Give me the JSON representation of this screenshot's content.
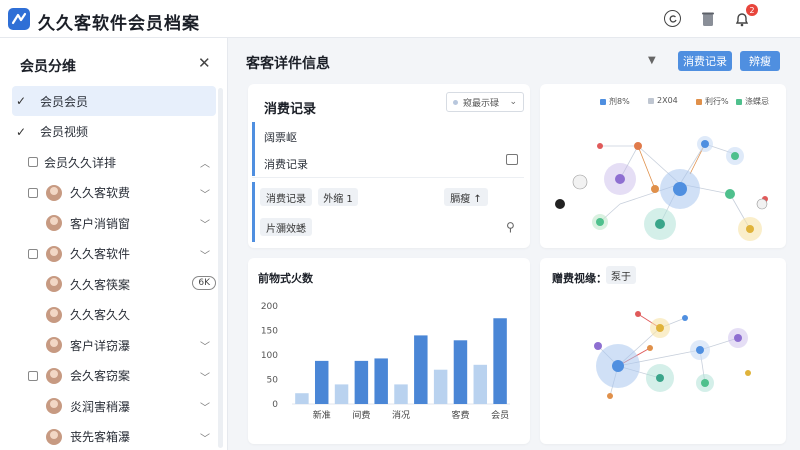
{
  "header": {
    "title": "久久客软件会员档案",
    "notification_count": "2"
  },
  "sidebar": {
    "title": "会员分维",
    "items": [
      {
        "label": "会员会员",
        "kind": "check",
        "active": true
      },
      {
        "label": "会员视频",
        "kind": "check"
      },
      {
        "label": "会员久久详排",
        "kind": "box",
        "chevron": "up"
      },
      {
        "label": "久久客软费",
        "kind": "box-avatar",
        "chevron": "down"
      },
      {
        "label": "客户消销窗",
        "kind": "avatar",
        "chevron": "down"
      },
      {
        "label": "久久客软件",
        "kind": "box-avatar",
        "chevron": "down"
      },
      {
        "label": "久久客筷案",
        "kind": "avatar",
        "pill": "6K"
      },
      {
        "label": "久久客久久",
        "kind": "avatar"
      },
      {
        "label": "客户详窃瀑",
        "kind": "avatar",
        "chevron": "down"
      },
      {
        "label": "会久客窃案",
        "kind": "box-avatar",
        "chevron": "down"
      },
      {
        "label": "炎润害稍瀑",
        "kind": "avatar",
        "chevron": "down"
      },
      {
        "label": "丧先客箱瀑",
        "kind": "avatar",
        "chevron": "down"
      }
    ]
  },
  "main": {
    "title": "客客详件信息",
    "buttons": {
      "primary": "消费记录",
      "secondary": "辨瘦"
    }
  },
  "records_card": {
    "title": "消费记录",
    "select_value": "窥最示碌",
    "rows": [
      "阔票岖",
      "消费记录"
    ],
    "tags": [
      "消费记录",
      "外缩 1"
    ],
    "sort_tag": "膈瘦 ↑",
    "extra_tag": "片瀰效蟋"
  },
  "network_top": {
    "legend": [
      {
        "label": "剂8%",
        "color": "#4f8fe0"
      },
      {
        "label": "2X04",
        "color": "#bfc6d1"
      },
      {
        "label": "利行%",
        "color": "#e0904a"
      },
      {
        "label": "涤蝶忌",
        "color": "#4fc08d"
      }
    ]
  },
  "chart_card": {
    "title": "前物式火数"
  },
  "chart_data": {
    "type": "bar",
    "categories": [
      "新准",
      "间费",
      "消况",
      "客费",
      "会员"
    ],
    "series": [
      {
        "color": "#4a86d6",
        "values": [
          88,
          88,
          93,
          140,
          130,
          175
        ],
        "offsets": [
          0,
          0,
          0,
          0,
          0,
          0
        ]
      },
      {
        "color": "#b9d2ef",
        "values": [
          22,
          40,
          40,
          70,
          80
        ],
        "offsets": [
          0,
          0,
          0,
          0,
          0
        ]
      }
    ],
    "bars": [
      {
        "x": 0,
        "v": 22,
        "c": "light"
      },
      {
        "x": 1,
        "v": 88,
        "c": "dark"
      },
      {
        "x": 2,
        "v": 40,
        "c": "light"
      },
      {
        "x": 3,
        "v": 88,
        "c": "dark"
      },
      {
        "x": 4,
        "v": 93,
        "c": "dark"
      },
      {
        "x": 5,
        "v": 40,
        "c": "light"
      },
      {
        "x": 6,
        "v": 140,
        "c": "dark"
      },
      {
        "x": 7,
        "v": 70,
        "c": "light"
      },
      {
        "x": 8,
        "v": 130,
        "c": "dark"
      },
      {
        "x": 9,
        "v": 80,
        "c": "light"
      },
      {
        "x": 10,
        "v": 175,
        "c": "dark"
      }
    ],
    "yticks": [
      0,
      50,
      100,
      150,
      200
    ],
    "ylim": [
      0,
      200
    ],
    "title": "前物式火数"
  },
  "network_bottom": {
    "title": "赠费视缘：",
    "tag": "泵于"
  }
}
